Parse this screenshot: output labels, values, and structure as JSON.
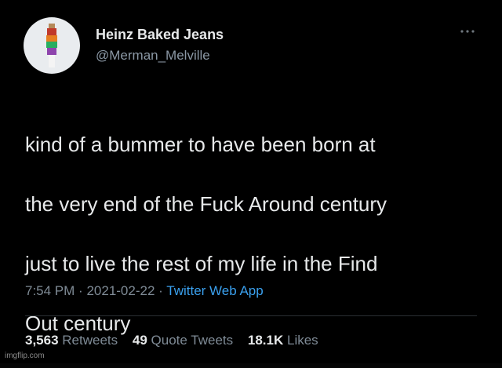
{
  "author": {
    "display_name": "Heinz Baked Jeans",
    "handle": "@Merman_Melville"
  },
  "tweet": {
    "lines": [
      "kind of a bummer to have been born at",
      "the very end of the Fuck Around century",
      "just to live the rest of my life in the Find",
      "Out century"
    ],
    "time": "7:54 PM",
    "date": "2021-02-22",
    "separator": "·",
    "source": "Twitter Web App"
  },
  "stats": {
    "retweets_count": "3,563",
    "retweets_label": "Retweets",
    "quotes_count": "49",
    "quotes_label": "Quote Tweets",
    "likes_count": "18.1K",
    "likes_label": "Likes"
  },
  "watermark": "imgflip.com",
  "icons": {
    "more": "more-horizontal-icon",
    "avatar": "avatar-image"
  },
  "colors": {
    "background": "#000000",
    "primary_text": "#e7e9ea",
    "secondary_text": "#8b98a5",
    "link": "#3aa0ee"
  }
}
